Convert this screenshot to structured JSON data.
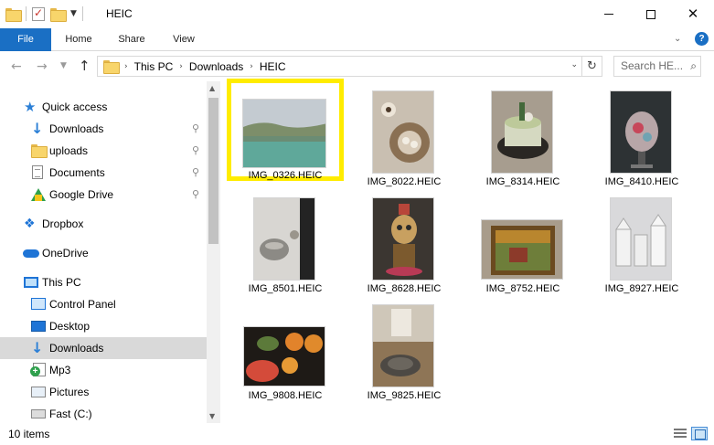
{
  "window": {
    "title": "HEIC",
    "controls": {
      "minimize": "minimize",
      "maximize": "maximize",
      "close": "close"
    }
  },
  "ribbon": {
    "tabs": [
      {
        "label": "File",
        "active": true
      },
      {
        "label": "Home"
      },
      {
        "label": "Share"
      },
      {
        "label": "View"
      }
    ]
  },
  "address": {
    "crumbs": [
      "This PC",
      "Downloads",
      "HEIC"
    ],
    "search_placeholder": "Search HE..."
  },
  "nav": {
    "items": [
      {
        "label": "Quick access",
        "icon": "star-icon",
        "pinned": false
      },
      {
        "label": "Downloads",
        "icon": "download-arrow-icon",
        "pinned": true
      },
      {
        "label": "uploads",
        "icon": "folder-icon",
        "pinned": true
      },
      {
        "label": "Documents",
        "icon": "document-icon",
        "pinned": true
      },
      {
        "label": "Google Drive",
        "icon": "google-drive-icon",
        "pinned": true
      },
      {
        "label": "Dropbox",
        "icon": "dropbox-icon",
        "pinned": false
      },
      {
        "label": "OneDrive",
        "icon": "cloud-icon",
        "pinned": false
      },
      {
        "label": "This PC",
        "icon": "computer-icon",
        "pinned": false
      },
      {
        "label": "Control Panel",
        "icon": "control-panel-icon",
        "pinned": false
      },
      {
        "label": "Desktop",
        "icon": "desktop-icon",
        "pinned": false
      },
      {
        "label": "Downloads",
        "icon": "download-arrow-icon",
        "pinned": false,
        "selected": true
      },
      {
        "label": "Mp3",
        "icon": "mp3-library-icon",
        "pinned": false
      },
      {
        "label": "Pictures",
        "icon": "pictures-icon",
        "pinned": false
      },
      {
        "label": "Fast (C:)",
        "icon": "drive-icon",
        "pinned": false
      }
    ]
  },
  "files": [
    {
      "name": "IMG_0326.HEIC",
      "highlighted": true
    },
    {
      "name": "IMG_8022.HEIC"
    },
    {
      "name": "IMG_8314.HEIC"
    },
    {
      "name": "IMG_8410.HEIC"
    },
    {
      "name": "IMG_8501.HEIC"
    },
    {
      "name": "IMG_8628.HEIC"
    },
    {
      "name": "IMG_8752.HEIC"
    },
    {
      "name": "IMG_8927.HEIC"
    },
    {
      "name": "IMG_9808.HEIC"
    },
    {
      "name": "IMG_9825.HEIC"
    }
  ],
  "status": {
    "item_count": "10 items"
  },
  "colors": {
    "accent": "#1a6fc4",
    "highlight_border": "#ffec00",
    "selected_nav": "#d9d9d9"
  }
}
